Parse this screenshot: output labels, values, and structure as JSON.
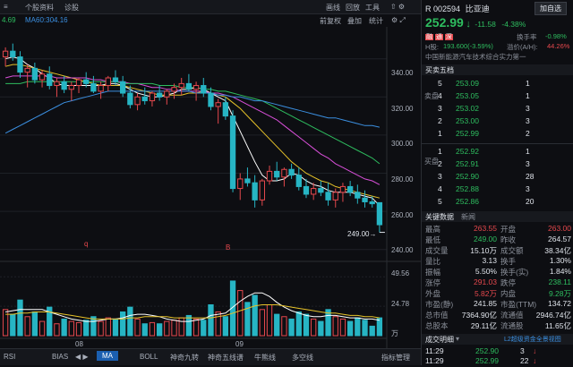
{
  "topbar": {
    "menu_icon": "≡",
    "tab_profile": "个股资料",
    "tab_review": "诊股",
    "btn_draw": "画线",
    "btn_replay": "回放",
    "btn_tools": "工具",
    "tool_icons": "⇧ ⚙"
  },
  "mabar": {
    "ma_left": "4.69",
    "ma60": "MA60:304.16",
    "options": [
      "前复权",
      "叠加",
      "统计"
    ]
  },
  "price_labels": [
    "340.00",
    "320.00",
    "300.00",
    "280.00",
    "260.00",
    "240.00"
  ],
  "price_markers": {
    "low_label": "249.00→",
    "event_q": "q",
    "event_bonus": "B"
  },
  "volume_labels": [
    "49.56",
    "24.78",
    "万"
  ],
  "date_labels": [
    "08",
    "09"
  ],
  "tabs": [
    "RSI",
    "BIAS",
    "MA",
    "BOLL",
    "神奇九转",
    "神奇五线谱",
    "牛熊线",
    "多空线"
  ],
  "active_tab": "MA",
  "indicator_manage": "指标管理",
  "stock": {
    "code": "R 002594",
    "name": "比亚迪",
    "add_button": "加自选",
    "price": "252.99",
    "arrow": "↓",
    "change": "-11.58",
    "change_pct": "-4.38%",
    "badges": [
      "融",
      "通",
      "深"
    ],
    "turnover_label": "换手率",
    "turnover_value": "-0.98%",
    "h_label": "H股:",
    "h_value": "193.600(-3.59%)",
    "premium_label": "溢价(A/H):",
    "premium_value": "44.26%",
    "slogan": "中国新能源汽车技术综合实力第一"
  },
  "orderbook": {
    "title": "买卖五档",
    "sell_label": "卖盘",
    "buy_label": "买盘",
    "sell": [
      {
        "level": "5",
        "price": "253.09",
        "vol": "1"
      },
      {
        "level": "4",
        "price": "253.05",
        "vol": "1"
      },
      {
        "level": "3",
        "price": "253.02",
        "vol": "3"
      },
      {
        "level": "2",
        "price": "253.00",
        "vol": "3"
      },
      {
        "level": "1",
        "price": "252.99",
        "vol": "2"
      }
    ],
    "buy": [
      {
        "level": "1",
        "price": "252.92",
        "vol": "1"
      },
      {
        "level": "2",
        "price": "252.91",
        "vol": "3"
      },
      {
        "level": "3",
        "price": "252.90",
        "vol": "28"
      },
      {
        "level": "4",
        "price": "252.88",
        "vol": "3"
      },
      {
        "level": "5",
        "price": "252.86",
        "vol": "20"
      }
    ]
  },
  "keydata": {
    "title": "关键数据",
    "tab2": "新闻",
    "rows": [
      [
        [
          "最高",
          "263.55",
          "red"
        ],
        [
          "开盘",
          "263.00",
          "red"
        ]
      ],
      [
        [
          "最低",
          "249.00",
          "green"
        ],
        [
          "昨收",
          "264.57",
          "white"
        ]
      ],
      [
        [
          "成交量",
          "15.10万",
          "white"
        ],
        [
          "成交额",
          "38.34亿",
          "white"
        ]
      ],
      [
        [
          "量比",
          "3.13",
          "white"
        ],
        [
          "换手",
          "1.30%",
          "white"
        ]
      ],
      [
        [
          "振幅",
          "5.50%",
          "white"
        ],
        [
          "换手(实)",
          "1.84%",
          "white"
        ]
      ],
      [
        [
          "涨停",
          "291.03",
          "red"
        ],
        [
          "跌停",
          "238.11",
          "green"
        ]
      ],
      [
        [
          "外盘",
          "5.82万",
          "red"
        ],
        [
          "内盘",
          "9.28万",
          "green"
        ]
      ],
      [
        [
          "市盈(静)",
          "241.85",
          "white"
        ],
        [
          "市盈(TTM)",
          "134.72",
          "white"
        ]
      ],
      [
        [
          "总市值",
          "7364.90亿",
          "white"
        ],
        [
          "流通值",
          "2946.74亿",
          "white"
        ]
      ],
      [
        [
          "总股本",
          "29.11亿",
          "white"
        ],
        [
          "流通股",
          "11.65亿",
          "white"
        ]
      ]
    ]
  },
  "trades": {
    "title": "成交明细",
    "menu": "▾",
    "link": "L2超级资金全景视图",
    "rows": [
      {
        "time": "11:29",
        "price": "252.90",
        "vol": "3"
      },
      {
        "time": "11:29",
        "price": "252.99",
        "vol": "22"
      }
    ]
  },
  "chart_data": {
    "type": "candlestick",
    "x": [
      "08",
      "09"
    ],
    "price_axis": {
      "ticks": [
        340,
        320,
        300,
        280,
        260,
        240
      ],
      "ylim": [
        238,
        353
      ]
    },
    "volume_axis": {
      "ticks": [
        49.56,
        24.78
      ],
      "unit": "万"
    },
    "annotations": [
      "249.00",
      "q",
      "B"
    ],
    "ma60_last": 304.16,
    "candles": [
      {
        "o": 341,
        "h": 346,
        "l": 336,
        "c": 344,
        "v": 22
      },
      {
        "o": 344,
        "h": 348,
        "l": 339,
        "c": 341,
        "v": 18
      },
      {
        "o": 341,
        "h": 344,
        "l": 330,
        "c": 333,
        "v": 30
      },
      {
        "o": 333,
        "h": 337,
        "l": 325,
        "c": 335,
        "v": 16
      },
      {
        "o": 335,
        "h": 338,
        "l": 327,
        "c": 329,
        "v": 20
      },
      {
        "o": 329,
        "h": 334,
        "l": 325,
        "c": 332,
        "v": 12
      },
      {
        "o": 332,
        "h": 336,
        "l": 324,
        "c": 326,
        "v": 24
      },
      {
        "o": 326,
        "h": 330,
        "l": 320,
        "c": 328,
        "v": 10
      },
      {
        "o": 328,
        "h": 331,
        "l": 322,
        "c": 324,
        "v": 14
      },
      {
        "o": 324,
        "h": 328,
        "l": 318,
        "c": 326,
        "v": 12
      },
      {
        "o": 326,
        "h": 330,
        "l": 322,
        "c": 329,
        "v": 11
      },
      {
        "o": 329,
        "h": 333,
        "l": 325,
        "c": 327,
        "v": 13
      },
      {
        "o": 327,
        "h": 331,
        "l": 322,
        "c": 323,
        "v": 16
      },
      {
        "o": 323,
        "h": 328,
        "l": 319,
        "c": 326,
        "v": 12
      },
      {
        "o": 326,
        "h": 331,
        "l": 323,
        "c": 330,
        "v": 15
      },
      {
        "o": 330,
        "h": 334,
        "l": 326,
        "c": 328,
        "v": 14
      },
      {
        "o": 328,
        "h": 331,
        "l": 320,
        "c": 322,
        "v": 20
      },
      {
        "o": 322,
        "h": 326,
        "l": 314,
        "c": 316,
        "v": 24
      },
      {
        "o": 316,
        "h": 322,
        "l": 313,
        "c": 320,
        "v": 14
      },
      {
        "o": 320,
        "h": 325,
        "l": 316,
        "c": 318,
        "v": 10
      },
      {
        "o": 318,
        "h": 323,
        "l": 315,
        "c": 322,
        "v": 11
      },
      {
        "o": 322,
        "h": 326,
        "l": 318,
        "c": 320,
        "v": 10
      },
      {
        "o": 320,
        "h": 324,
        "l": 316,
        "c": 323,
        "v": 12
      },
      {
        "o": 323,
        "h": 327,
        "l": 319,
        "c": 325,
        "v": 13
      },
      {
        "o": 325,
        "h": 330,
        "l": 321,
        "c": 327,
        "v": 15
      },
      {
        "o": 327,
        "h": 332,
        "l": 323,
        "c": 324,
        "v": 17
      },
      {
        "o": 324,
        "h": 328,
        "l": 318,
        "c": 326,
        "v": 14
      },
      {
        "o": 326,
        "h": 330,
        "l": 320,
        "c": 322,
        "v": 13
      },
      {
        "o": 322,
        "h": 325,
        "l": 313,
        "c": 315,
        "v": 26
      },
      {
        "o": 315,
        "h": 319,
        "l": 306,
        "c": 317,
        "v": 20
      },
      {
        "o": 317,
        "h": 320,
        "l": 308,
        "c": 310,
        "v": 16
      },
      {
        "o": 310,
        "h": 313,
        "l": 270,
        "c": 272,
        "v": 46
      },
      {
        "o": 272,
        "h": 280,
        "l": 266,
        "c": 277,
        "v": 38
      },
      {
        "o": 277,
        "h": 283,
        "l": 273,
        "c": 275,
        "v": 28
      },
      {
        "o": 275,
        "h": 279,
        "l": 262,
        "c": 266,
        "v": 34
      },
      {
        "o": 266,
        "h": 277,
        "l": 263,
        "c": 276,
        "v": 22
      },
      {
        "o": 276,
        "h": 284,
        "l": 274,
        "c": 281,
        "v": 26
      },
      {
        "o": 281,
        "h": 286,
        "l": 276,
        "c": 278,
        "v": 18
      },
      {
        "o": 278,
        "h": 283,
        "l": 273,
        "c": 282,
        "v": 16
      },
      {
        "o": 282,
        "h": 285,
        "l": 277,
        "c": 279,
        "v": 14
      },
      {
        "o": 279,
        "h": 283,
        "l": 271,
        "c": 273,
        "v": 20
      },
      {
        "o": 273,
        "h": 277,
        "l": 267,
        "c": 269,
        "v": 18
      },
      {
        "o": 269,
        "h": 275,
        "l": 266,
        "c": 272,
        "v": 14
      },
      {
        "o": 272,
        "h": 276,
        "l": 268,
        "c": 270,
        "v": 12
      },
      {
        "o": 270,
        "h": 275,
        "l": 263,
        "c": 266,
        "v": 22
      },
      {
        "o": 266,
        "h": 272,
        "l": 262,
        "c": 270,
        "v": 16
      },
      {
        "o": 270,
        "h": 275,
        "l": 265,
        "c": 273,
        "v": 14
      },
      {
        "o": 273,
        "h": 276,
        "l": 268,
        "c": 270,
        "v": 12
      },
      {
        "o": 270,
        "h": 274,
        "l": 264,
        "c": 267,
        "v": 15
      },
      {
        "o": 267,
        "h": 271,
        "l": 262,
        "c": 265,
        "v": 13
      },
      {
        "o": 265,
        "h": 268,
        "l": 262,
        "c": 264,
        "v": 8
      },
      {
        "o": 264.57,
        "h": 263.55,
        "l": 249,
        "c": 252.99,
        "v": 15
      }
    ],
    "ma_lines": [
      {
        "name": "MA5",
        "color": "#ffffff",
        "values": [
          340,
          341,
          340,
          337,
          335,
          332,
          330,
          327,
          326,
          326,
          326,
          326,
          326,
          326,
          327,
          327,
          326,
          324,
          322,
          321,
          320,
          320,
          321,
          322,
          324,
          324,
          325,
          324,
          322,
          320,
          318,
          310,
          302,
          294,
          286,
          279,
          276,
          276,
          277,
          280,
          279,
          276,
          274,
          273,
          271,
          270,
          270,
          270,
          269,
          268,
          267,
          263
        ]
      },
      {
        "name": "MA10",
        "color": "#e6c229",
        "values": [
          336,
          337,
          337,
          336,
          335,
          334,
          333,
          332,
          331,
          330,
          329,
          328,
          327,
          326,
          326,
          326,
          326,
          325,
          324,
          323,
          322,
          321,
          321,
          321,
          321,
          322,
          322,
          323,
          322,
          321,
          320,
          317,
          314,
          310,
          306,
          302,
          298,
          294,
          290,
          286,
          283,
          280,
          278,
          276,
          275,
          273,
          272,
          271,
          270,
          269,
          268,
          267
        ]
      },
      {
        "name": "MA20",
        "color": "#d84fd8",
        "values": [
          330,
          331,
          331,
          331,
          331,
          331,
          331,
          330,
          330,
          330,
          330,
          330,
          329,
          329,
          328,
          328,
          328,
          327,
          327,
          326,
          325,
          325,
          324,
          324,
          323,
          323,
          323,
          323,
          322,
          322,
          321,
          320,
          318,
          316,
          314,
          312,
          310,
          308,
          305,
          302,
          299,
          296,
          293,
          290,
          288,
          285,
          283,
          281,
          279,
          277,
          276,
          274
        ]
      },
      {
        "name": "MA30",
        "color": "#2ebd5f",
        "values": [
          327,
          327,
          327,
          328,
          328,
          328,
          328,
          328,
          328,
          328,
          328,
          328,
          328,
          328,
          328,
          328,
          327,
          327,
          327,
          327,
          327,
          326,
          326,
          326,
          325,
          325,
          325,
          324,
          324,
          323,
          323,
          322,
          321,
          320,
          319,
          318,
          316,
          314,
          312,
          310,
          308,
          306,
          304,
          302,
          300,
          298,
          296,
          294,
          292,
          290,
          288,
          285
        ]
      },
      {
        "name": "MA60",
        "color": "#3b8fe0",
        "values": [
          301,
          303,
          305,
          307,
          309,
          311,
          313,
          315,
          317,
          318,
          319,
          320,
          321,
          322,
          323,
          323,
          323,
          323,
          323,
          323,
          323,
          323,
          323,
          323,
          323,
          323,
          322,
          322,
          322,
          321,
          321,
          320,
          320,
          319,
          318,
          318,
          317,
          316,
          315,
          314,
          313,
          312,
          311,
          310,
          309,
          309,
          308,
          307,
          306,
          305,
          305,
          304.16
        ]
      }
    ],
    "vol_ma": [
      {
        "color": "#ffffff",
        "values": [
          20,
          21,
          22,
          22,
          22,
          22,
          20,
          18,
          16,
          14,
          13,
          12,
          12,
          13,
          14,
          14,
          15,
          17,
          18,
          18,
          17,
          16,
          14,
          13,
          12,
          12,
          13,
          14,
          17,
          18,
          19,
          24,
          29,
          33,
          36,
          36,
          33,
          28,
          24,
          21,
          19,
          17,
          16,
          16,
          17,
          17,
          16,
          15,
          15,
          14,
          14,
          13
        ]
      },
      {
        "color": "#e6c229",
        "values": [
          18,
          18,
          19,
          19,
          20,
          20,
          20,
          19,
          18,
          17,
          16,
          15,
          14,
          14,
          14,
          14,
          14,
          15,
          15,
          16,
          16,
          16,
          16,
          15,
          15,
          15,
          15,
          15,
          15,
          16,
          17,
          19,
          21,
          23,
          25,
          26,
          26,
          26,
          25,
          24,
          23,
          22,
          21,
          20,
          19,
          19,
          18,
          17,
          17,
          16,
          16,
          15
        ]
      }
    ]
  }
}
